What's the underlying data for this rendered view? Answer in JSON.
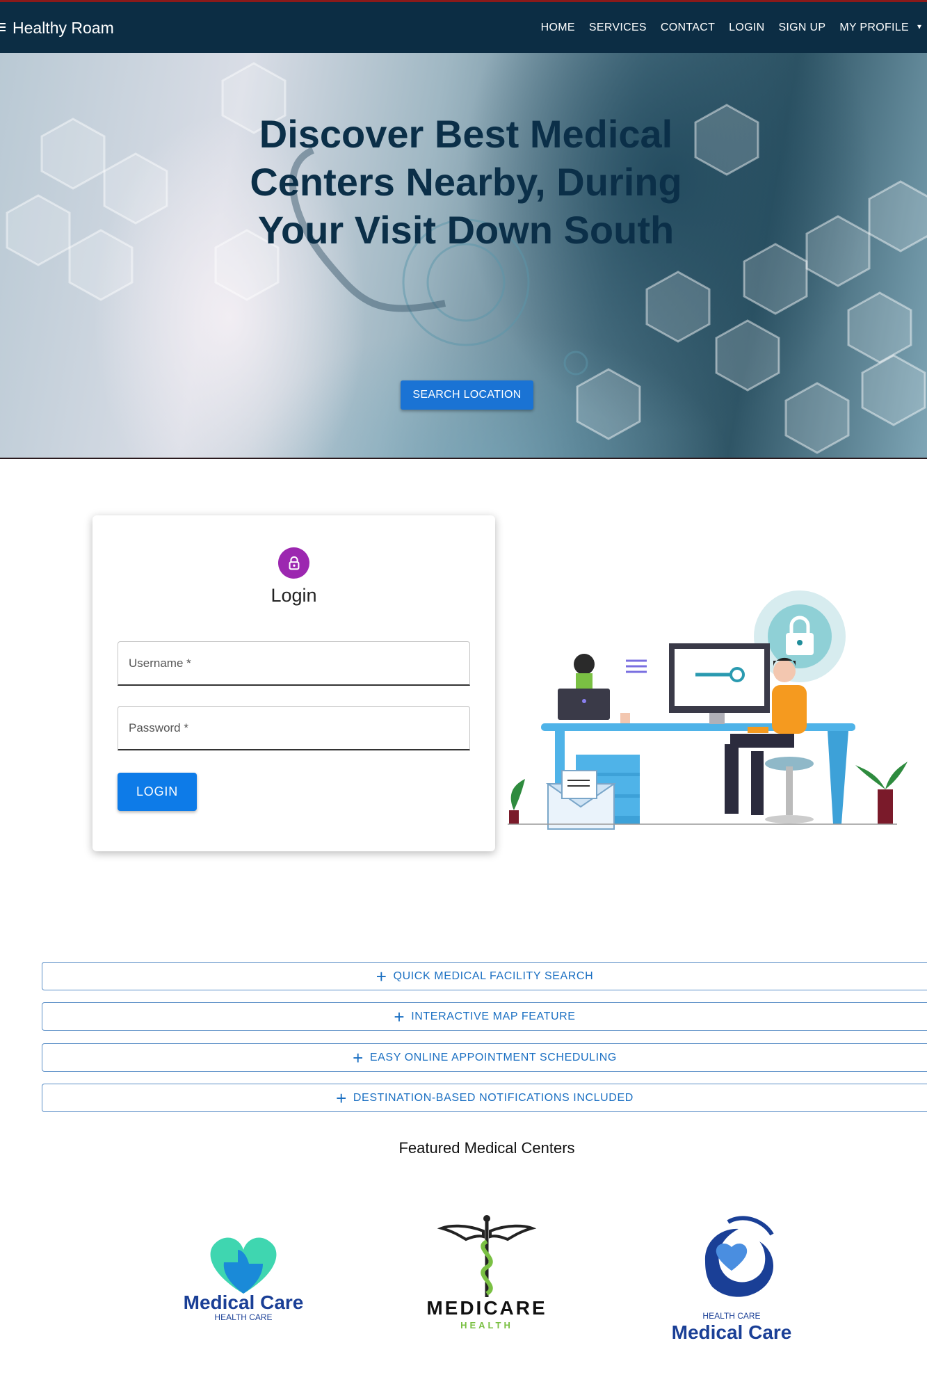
{
  "navbar": {
    "brand": "Healthy Roam",
    "links": [
      "HOME",
      "SERVICES",
      "CONTACT",
      "LOGIN",
      "SIGN UP",
      "MY PROFILE"
    ]
  },
  "hero": {
    "title": "Discover Best Medical Centers Nearby, During Your Visit Down South",
    "button_label": "SEARCH LOCATION"
  },
  "login": {
    "title": "Login",
    "username_placeholder": "Username *",
    "password_placeholder": "Password *",
    "button_label": "LOGIN"
  },
  "accordion": {
    "items": [
      "QUICK MEDICAL FACILITY SEARCH",
      "INTERACTIVE MAP FEATURE",
      "EASY ONLINE APPOINTMENT SCHEDULING",
      "DESTINATION-BASED NOTIFICATIONS INCLUDED"
    ]
  },
  "featured": {
    "title": "Featured Medical Centers",
    "logos": [
      {
        "name": "Medical Care",
        "sub": "HEALTH CARE"
      },
      {
        "name": "MEDICARE",
        "sub": "HEALTH"
      },
      {
        "name": "Medical Care",
        "sub": "HEALTH CARE"
      }
    ]
  },
  "colors": {
    "navbar": "#0c2d44",
    "hero_title": "#0b2f48",
    "primary_button": "#1a73d4",
    "lock_avatar": "#9c27b0",
    "accordion_text": "#1a6fc2"
  },
  "icons": {
    "menu": "menu-icon",
    "lock": "lock-icon",
    "plus": "plus-icon"
  }
}
